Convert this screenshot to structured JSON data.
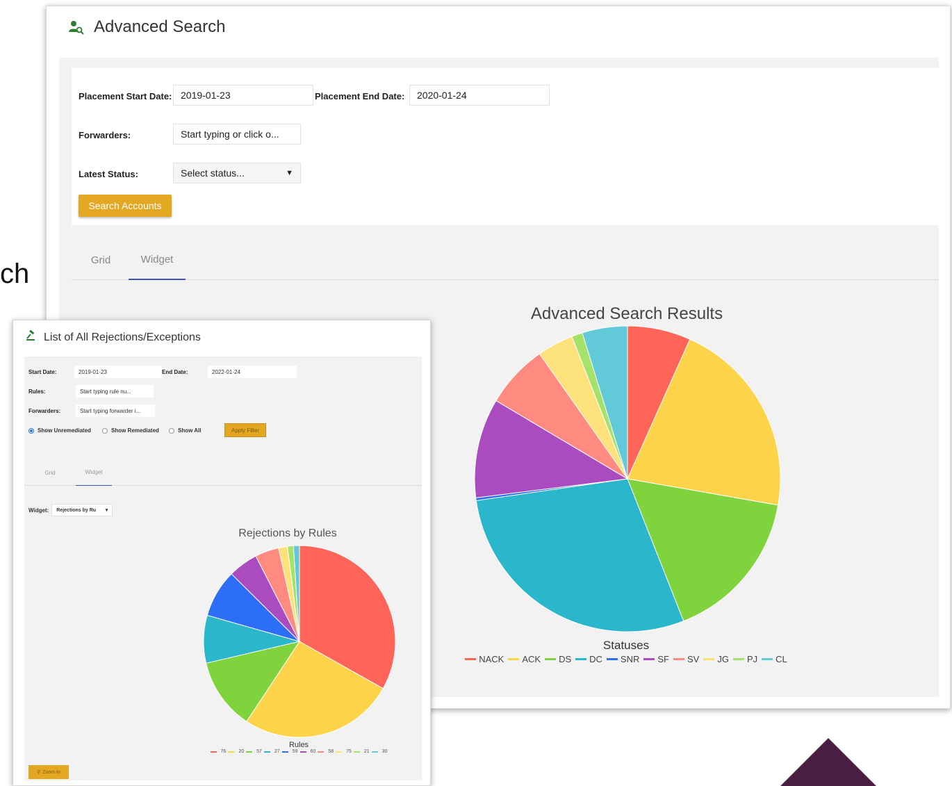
{
  "background": {
    "fragment_text": "ch"
  },
  "main_window": {
    "title": "Advanced Search",
    "filters": {
      "start_date_label": "Placement Start Date:",
      "start_date_value": "2019-01-23",
      "end_date_label": "Placement End Date:",
      "end_date_value": "2020-01-24",
      "forwarders_label": "Forwarders:",
      "forwarders_placeholder": "Start typing or click o...",
      "status_label": "Latest Status:",
      "status_value": "Select status...",
      "search_button": "Search Accounts"
    },
    "tabs": [
      {
        "label": "Grid",
        "active": false
      },
      {
        "label": "Widget",
        "active": true
      }
    ]
  },
  "sub_window": {
    "title": "List of All Rejections/Exceptions",
    "filters": {
      "start_date_label": "Start Date:",
      "start_date_value": "2019-01-23",
      "end_date_label": "End Date:",
      "end_date_value": "2022-01-24",
      "rules_label": "Rules:",
      "rules_placeholder": "Start typing rule nu...",
      "forwarders_label": "Forwarders:",
      "forwarders_placeholder": "Start typing forwarder i...",
      "radio_unremediated": "Show Unremediated",
      "radio_remediated": "Show Remediated",
      "radio_all": "Show All",
      "apply_button": "Apply Filter"
    },
    "tabs": [
      {
        "label": "Grid",
        "active": false
      },
      {
        "label": "Widget",
        "active": true
      }
    ],
    "widget_label": "Widget:",
    "widget_value": "Rejections by Ru",
    "zoom_button": "Zoom In"
  },
  "chart_data": [
    {
      "type": "pie",
      "title": "Advanced Search Results",
      "xlabel": "Statuses",
      "legend_position": "bottom",
      "categories": [
        "NACK",
        "ACK",
        "DS",
        "DC",
        "SNR",
        "SF",
        "SV",
        "JG",
        "PJ",
        "CL"
      ],
      "values": [
        7,
        22,
        17,
        30,
        0.3,
        11,
        7,
        4,
        1.2,
        5
      ],
      "colors": [
        "#ff6459",
        "#fdd34a",
        "#7fd43d",
        "#2ab6cb",
        "#2c6ef5",
        "#ab4bc0",
        "#ff8a80",
        "#fde17a",
        "#a5e26a",
        "#62c9d9"
      ]
    },
    {
      "type": "pie",
      "title": "Rejections by Rules",
      "xlabel": "Rules",
      "legend_position": "bottom",
      "categories": [
        "76",
        "20",
        "57",
        "27",
        "59",
        "60",
        "58",
        "75",
        "21",
        "30"
      ],
      "values": [
        33,
        26,
        12,
        8,
        8,
        5,
        4,
        1.5,
        1,
        1
      ],
      "colors": [
        "#ff6459",
        "#fdd34a",
        "#7fd43d",
        "#2ab6cb",
        "#2c6ef5",
        "#ab4bc0",
        "#ff8a80",
        "#fde17a",
        "#a5e26a",
        "#62c9d9"
      ]
    }
  ]
}
